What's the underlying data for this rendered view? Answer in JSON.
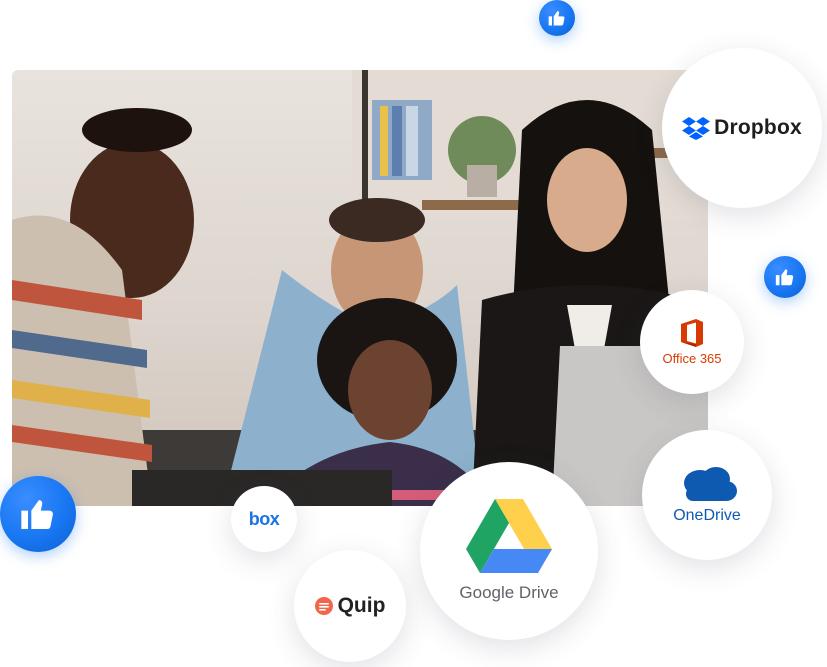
{
  "services": {
    "dropbox": "Dropbox",
    "office": "Office 365",
    "onedrive": "OneDrive",
    "gdrive": "Google Drive",
    "box": "box",
    "quip": "Quip"
  },
  "icons": {
    "like": "thumbs-up-icon",
    "dropbox": "dropbox-icon",
    "office": "office-icon",
    "onedrive": "onedrive-cloud-icon",
    "gdrive": "google-drive-icon",
    "quip": "quip-icon"
  },
  "colors": {
    "facebook_blue": "#1877f2",
    "dropbox_blue": "#0061fe",
    "office_orange": "#d83b01",
    "onedrive_blue": "#0f5ab1",
    "gdrive_green": "#1fa463",
    "gdrive_yellow": "#ffd04b",
    "gdrive_blue": "#4688f4",
    "quip_red": "#f2664b"
  }
}
